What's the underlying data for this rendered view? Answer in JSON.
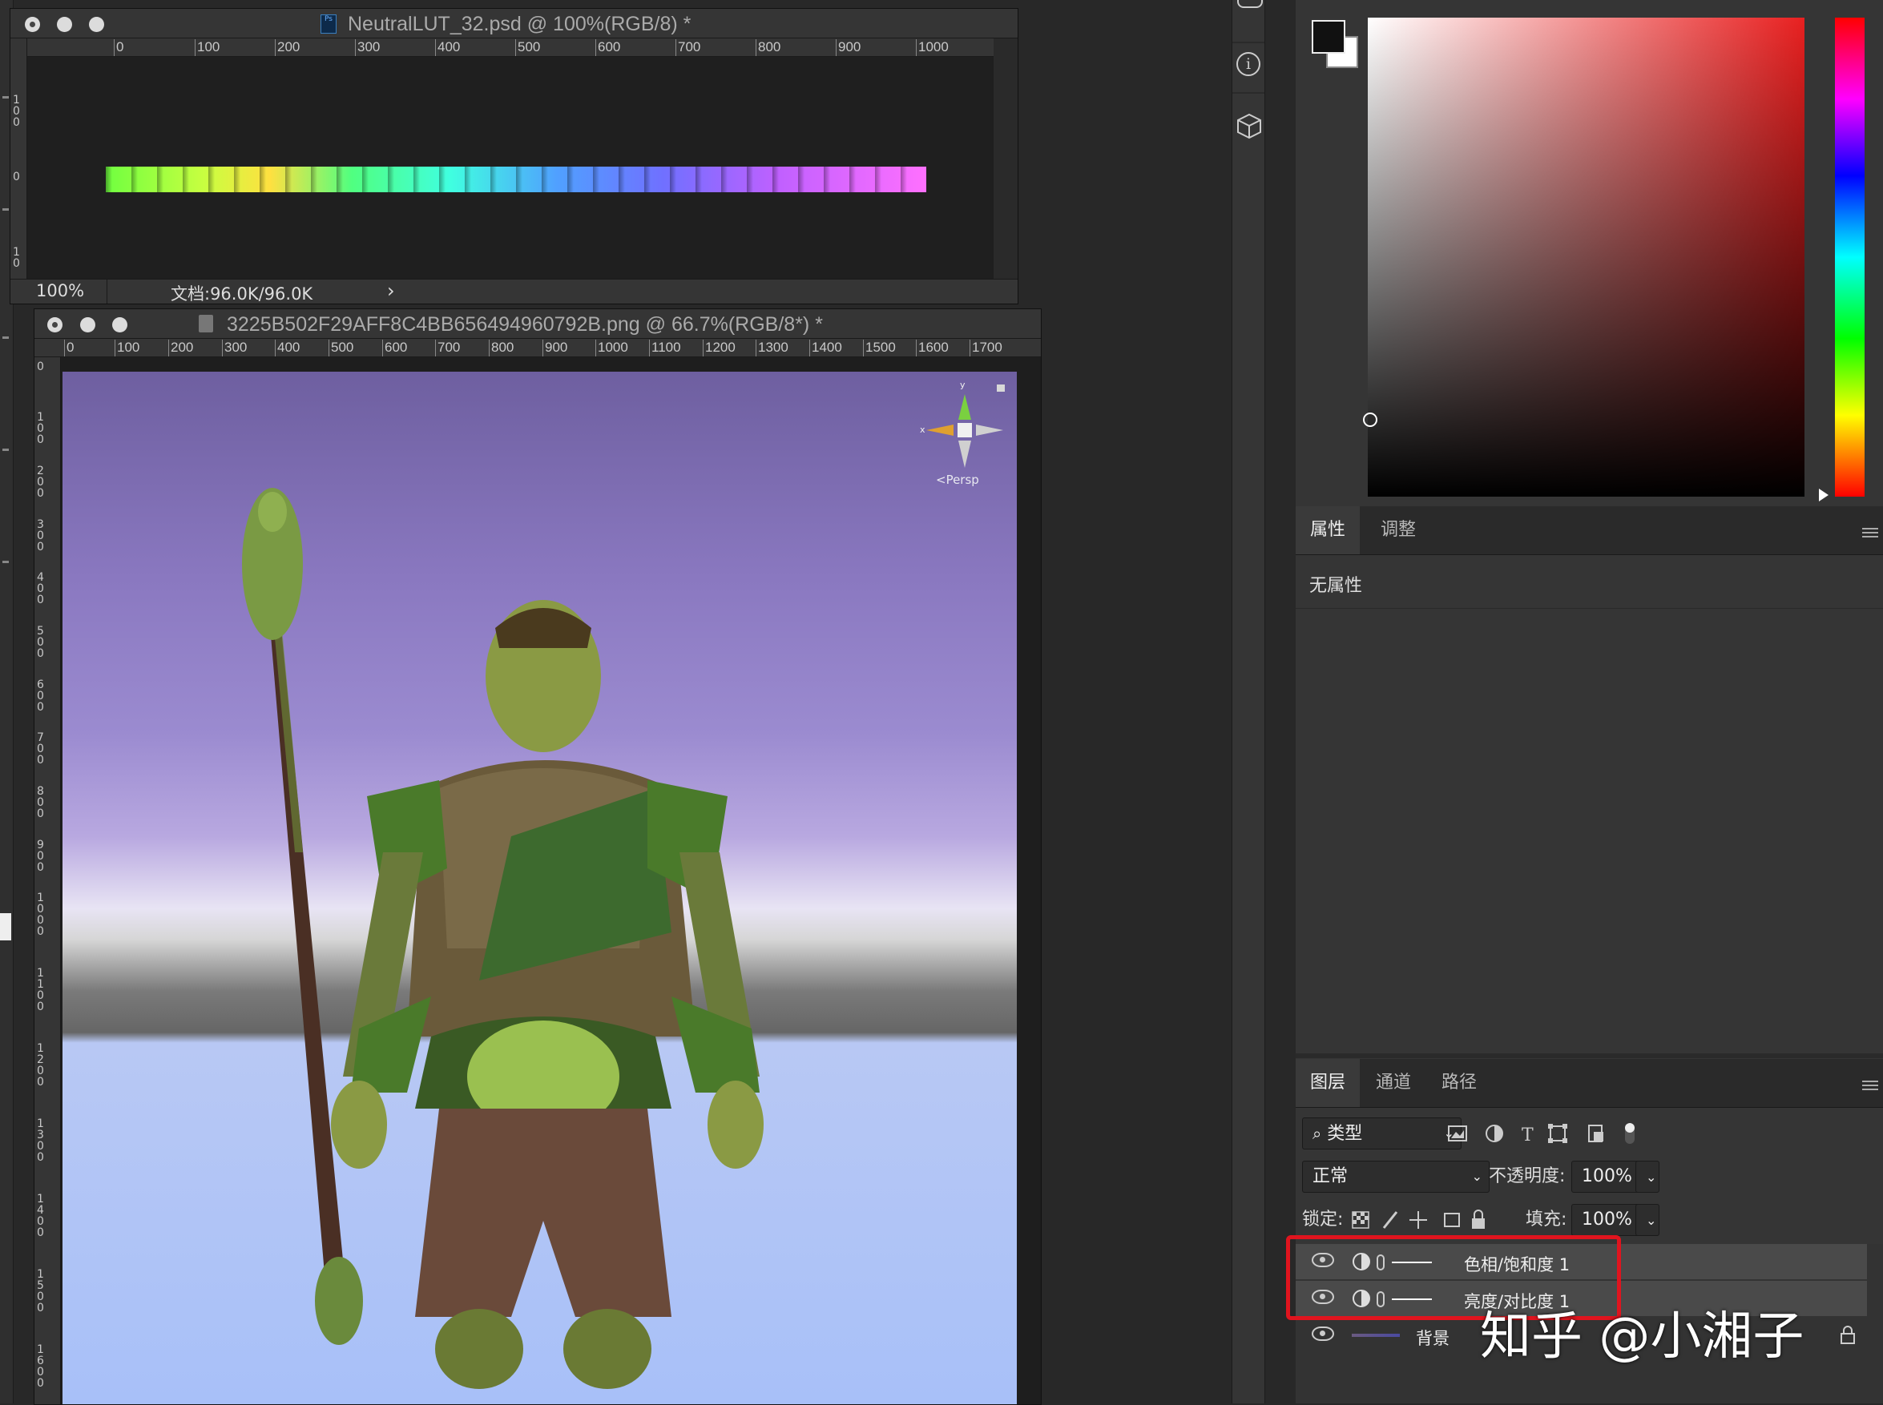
{
  "window_top": {
    "title": "NeutralLUT_32.psd @ 100%(RGB/8) *",
    "ruler_ticks": [
      "0",
      "100",
      "200",
      "300",
      "400",
      "500",
      "600",
      "700",
      "800",
      "900",
      "1000"
    ],
    "vruler_ticks": [
      "1 0 0",
      "0",
      "1 0"
    ],
    "zoom": "100%",
    "doc_info": "文档:96.0K/96.0K",
    "status_arrow": "›"
  },
  "window_main": {
    "title": "3225B502F29AFF8C4BB656494960792B.png @ 66.7%(RGB/8*) *",
    "ruler_ticks": [
      "0",
      "100",
      "200",
      "300",
      "400",
      "500",
      "600",
      "700",
      "800",
      "900",
      "1000",
      "1100",
      "1200",
      "1300",
      "1400",
      "1500",
      "1600",
      "1700"
    ],
    "vruler_ticks": [
      "0",
      "1 0 0",
      "2 0 0",
      "3 0 0",
      "4 0 0",
      "5 0 0",
      "6 0 0",
      "7 0 0",
      "8 0 0",
      "9 0 0",
      "1 0 0 0",
      "1 1 0 0",
      "1 2 0 0",
      "1 3 0 0",
      "1 4 0 0",
      "1 5 0 0",
      "1 6 0 0",
      "1 7 0 0"
    ],
    "gizmo_label": "<Persp",
    "gizmo_x": "x",
    "gizmo_y": "y"
  },
  "icons": [
    "history-icon",
    "info-icon",
    "3d-cube-icon"
  ],
  "color_picker": {
    "hue_color": "#e82020"
  },
  "properties_panel": {
    "tabs": [
      "属性",
      "调整"
    ],
    "active_tab": 0,
    "empty_text": "无属性"
  },
  "layers_panel": {
    "tabs": [
      "图层",
      "通道",
      "路径"
    ],
    "active_tab": 0,
    "filter_label": "类型",
    "blend_mode": "正常",
    "opacity_label": "不透明度:",
    "opacity_value": "100%",
    "lock_label": "锁定:",
    "fill_label": "填充:",
    "fill_value": "100%",
    "layers": [
      {
        "name": "色相/饱和度 1",
        "type": "adjustment",
        "visible": true
      },
      {
        "name": "亮度/对比度 1",
        "type": "adjustment",
        "visible": true
      },
      {
        "name": "背景",
        "type": "image",
        "visible": true,
        "locked": true
      }
    ]
  },
  "watermark": "知乎 @小湘子",
  "highlight_color": "#e0141e"
}
